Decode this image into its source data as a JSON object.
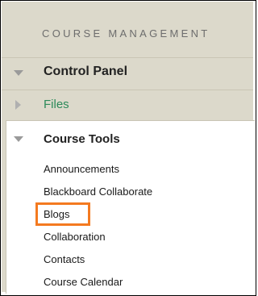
{
  "panel": {
    "section_header": "COURSE MANAGEMENT",
    "items": [
      {
        "label": "Control Panel",
        "expanded": true
      },
      {
        "label": "Files",
        "expanded": false
      }
    ]
  },
  "course_tools": {
    "title": "Course Tools",
    "expanded": true,
    "items": [
      "Announcements",
      "Blackboard Collaborate",
      "Blogs",
      "Collaboration",
      "Contacts",
      "Course Calendar"
    ],
    "highlighted_item": "Blogs"
  },
  "colors": {
    "panel_bg": "#dcd9cb",
    "files_link": "#2d8a5a",
    "highlight": "#f47a20"
  }
}
